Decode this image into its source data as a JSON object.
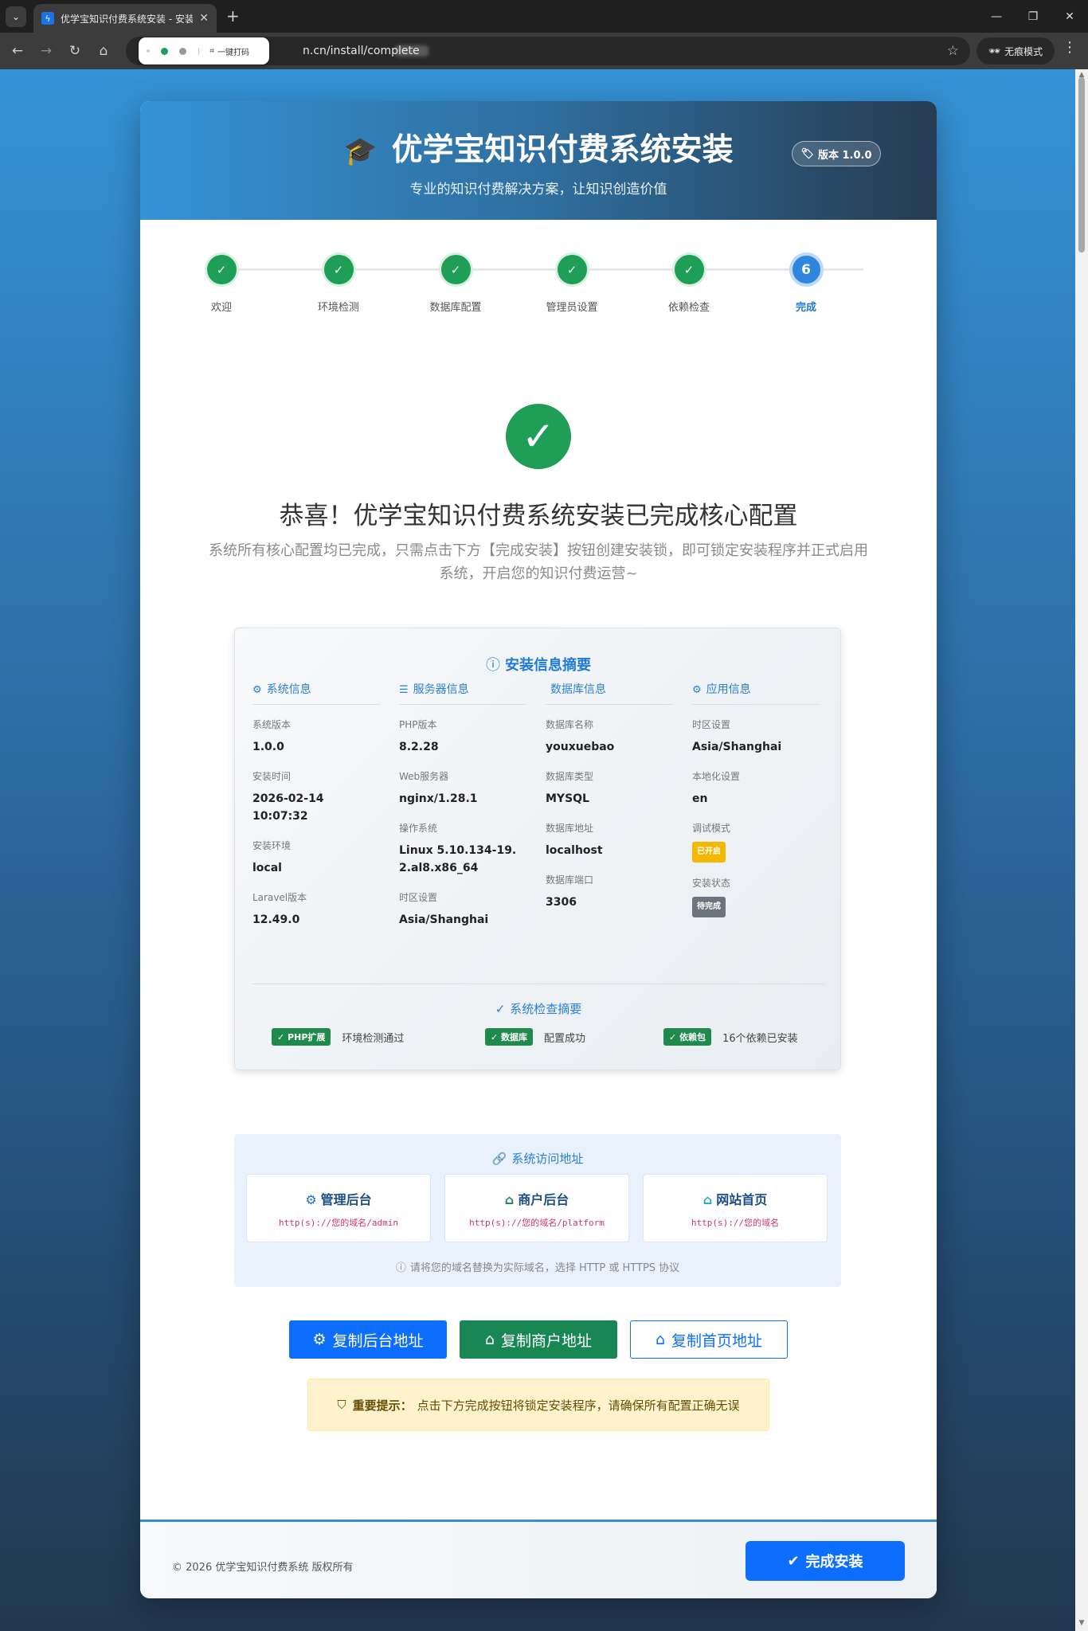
{
  "browser": {
    "tab_title": "优学宝知识付费系统安装 - 安装",
    "tab_favicon": "bolt-icon",
    "url": "n.cn/install/complete",
    "popup_text": "一键打码",
    "incognito_label": "无痕模式"
  },
  "header": {
    "title": "优学宝知识付费系统安装",
    "subtitle": "专业的知识付费解决方案，让知识创造价值",
    "version": "版本 1.0.0"
  },
  "steps": [
    {
      "label": "欢迎",
      "mark": "✓",
      "status": "done"
    },
    {
      "label": "环境检测",
      "mark": "✓",
      "status": "done"
    },
    {
      "label": "数据库配置",
      "mark": "✓",
      "status": "done"
    },
    {
      "label": "管理员设置",
      "mark": "✓",
      "status": "done"
    },
    {
      "label": "依赖检查",
      "mark": "✓",
      "status": "done"
    },
    {
      "label": "完成",
      "mark": "6",
      "status": "active"
    }
  ],
  "success": {
    "title": "恭喜！优学宝知识付费系统安装已完成核心配置",
    "desc_line1": "系统所有核心配置均已完成，只需点击下方【完成安装】按钮创建安装锁，即可锁定安装程序并正式启用",
    "desc_line2": "系统，开启您的知识付费运营~"
  },
  "summary": {
    "title": "安装信息摘要",
    "columns": {
      "system": {
        "title": "系统信息",
        "items": [
          {
            "label": "系统版本",
            "value": "1.0.0"
          },
          {
            "label": "安装时间",
            "value": "2026-02-14 10:07:32"
          },
          {
            "label": "安装环境",
            "value": "local"
          },
          {
            "label": "Laravel版本",
            "value": "12.49.0"
          }
        ]
      },
      "server": {
        "title": "服务器信息",
        "items": [
          {
            "label": "PHP版本",
            "value": "8.2.28"
          },
          {
            "label": "Web服务器",
            "value": "nginx/1.28.1"
          },
          {
            "label": "操作系统",
            "value": "Linux 5.10.134-19.2.al8.x86_64"
          },
          {
            "label": "时区设置",
            "value": "Asia/Shanghai"
          }
        ]
      },
      "database": {
        "title": "数据库信息",
        "items": [
          {
            "label": "数据库名称",
            "value": "youxuebao"
          },
          {
            "label": "数据库类型",
            "value": "MYSQL"
          },
          {
            "label": "数据库地址",
            "value": "localhost"
          },
          {
            "label": "数据库端口",
            "value": "3306"
          }
        ]
      },
      "app": {
        "title": "应用信息",
        "items": [
          {
            "label": "时区设置",
            "value": "Asia/Shanghai"
          },
          {
            "label": "本地化设置",
            "value": "en"
          },
          {
            "label": "调试模式",
            "value": "已开启"
          },
          {
            "label": "安装状态",
            "value": "待完成"
          }
        ]
      }
    },
    "check_title": "系统检查摘要",
    "checks": [
      {
        "badge": "✓ PHP扩展",
        "text": "环境检测通过"
      },
      {
        "badge": "✓ 数据库",
        "text": "配置成功"
      },
      {
        "badge": "✓ 依赖包",
        "text": "16个依赖已安装"
      }
    ]
  },
  "access": {
    "title": "系统访问地址",
    "cards": [
      {
        "name": "管理后台",
        "url": "http(s)://您的域名/admin"
      },
      {
        "name": "商户后台",
        "url": "http(s)://您的域名/platform"
      },
      {
        "name": "网站首页",
        "url": "http(s)://您的域名"
      }
    ],
    "note": "请将您的域名替换为实际域名，选择 HTTP 或 HTTPS 协议"
  },
  "buttons": {
    "copy_admin": "复制后台地址",
    "copy_platform": "复制商户地址",
    "copy_home": "复制首页地址",
    "finish": "完成安装"
  },
  "warning": {
    "label": "重要提示：",
    "text": "点击下方完成按钮将锁定安装程序，请确保所有配置正确无误"
  },
  "footer": {
    "copyright": "© 2026 优学宝知识付费系统 版权所有"
  },
  "colors": {
    "primary": "#0d6efd",
    "success": "#198754",
    "step_done": "#1e9e57",
    "step_active": "#2e86de",
    "warning_bg": "#fff3cd"
  }
}
